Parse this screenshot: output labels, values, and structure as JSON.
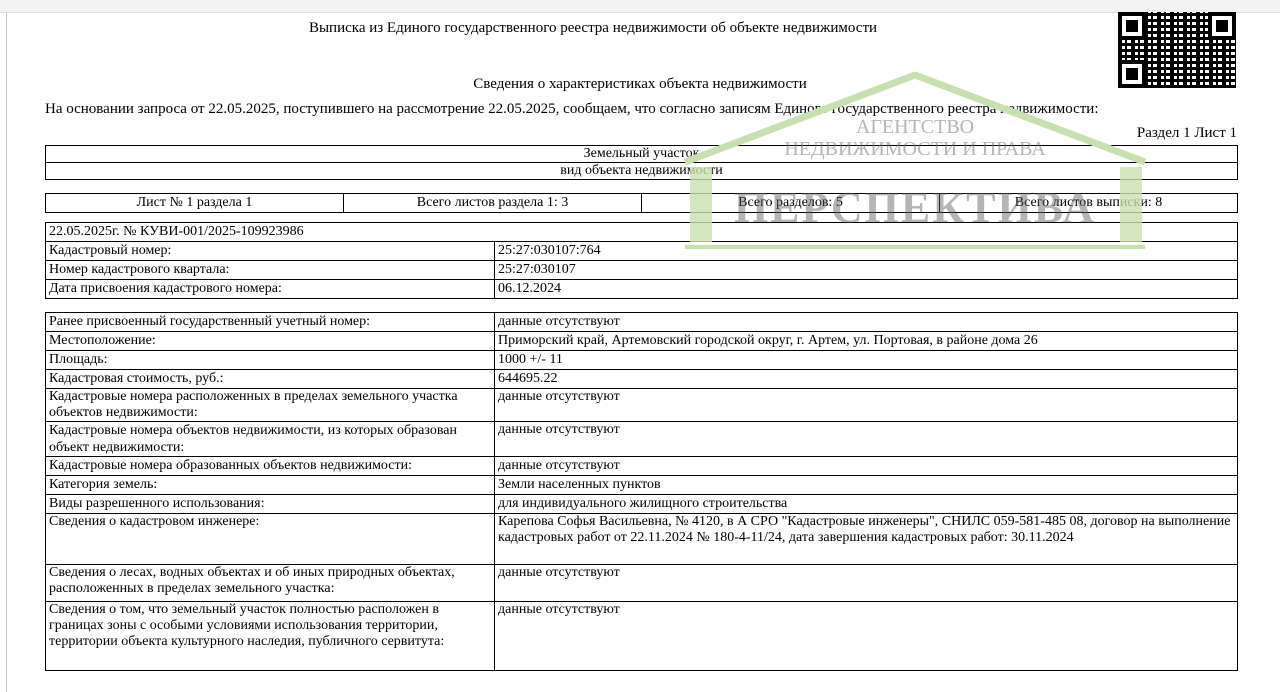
{
  "title": "Выписка из Единого государственного реестра недвижимости об объекте недвижимости",
  "subtitle": "Сведения о характеристиках объекта недвижимости",
  "intro": "На  основании запроса от 22.05.2025, поступившего на рассмотрение 22.05.2025, сообщаем, что согласно записям Единого государственного реестра недвижимости:",
  "section_label": "Раздел 1 Лист 1",
  "object_type": "Земельный участок",
  "object_type_caption": "вид объекта недвижимости",
  "sheet_info": [
    "Лист № 1 раздела 1",
    "Всего листов раздела 1: 3",
    "Всего разделов: 5",
    "Всего листов выписки: 8"
  ],
  "record_id": "22.05.2025г. № КУВИ-001/2025-109923986",
  "table1": [
    {
      "label": "Кадастровый номер:",
      "value": "25:27:030107:764"
    },
    {
      "label": "Номер кадастрового квартала:",
      "value": "25:27:030107"
    },
    {
      "label": "Дата присвоения кадастрового номера:",
      "value": "06.12.2024"
    }
  ],
  "table2": [
    {
      "label": "Ранее присвоенный государственный учетный номер:",
      "value": "данные отсутствуют"
    },
    {
      "label": "Местоположение:",
      "value": "Приморский край, Артемовский городской округ, г. Артем, ул. Портовая, в районе дома 26"
    },
    {
      "label": "Площадь:",
      "value": "1000 +/- 11"
    },
    {
      "label": "Кадастровая стоимость, руб.:",
      "value": "644695.22"
    },
    {
      "label": "Кадастровые номера расположенных в пределах земельного участка объектов недвижимости:",
      "value": "данные отсутствуют"
    },
    {
      "label": "Кадастровые номера объектов недвижимости, из которых образован объект недвижимости:",
      "value": "данные отсутствуют"
    },
    {
      "label": "Кадастровые номера образованных объектов недвижимости:",
      "value": "данные отсутствуют"
    },
    {
      "label": "Категория земель:",
      "value": "Земли населенных пунктов"
    },
    {
      "label": "Виды разрешенного использования:",
      "value": "для индивидуального жилищного строительства"
    },
    {
      "label": "Сведения о кадастровом инженере:",
      "value": "Карепова Софья Васильевна, № 4120, в А СРО \"Кадастровые инженеры\", СНИЛС 059-581-485 08, договор на выполнение кадастровых работ от 22.11.2024 № 180-4-11/24, дата завершения кадастровых работ: 30.11.2024"
    },
    {
      "label": "Сведения о лесах, водных объектах и об иных природных объектах, расположенных в пределах земельного участка:",
      "value": "данные отсутствуют"
    },
    {
      "label": "Сведения о том, что земельный участок полностью расположен в границах зоны с особыми условиями использования территории, территории объекта культурного наследия, публичного сервитута:",
      "value": "данные отсутствуют"
    }
  ],
  "watermark": {
    "line1": "АГЕНТСТВО",
    "line2": "НЕДВИЖИМОСТИ И ПРАВА",
    "brand": "ПЕРСПЕКТИВА",
    "color": "#c8e0b0"
  }
}
